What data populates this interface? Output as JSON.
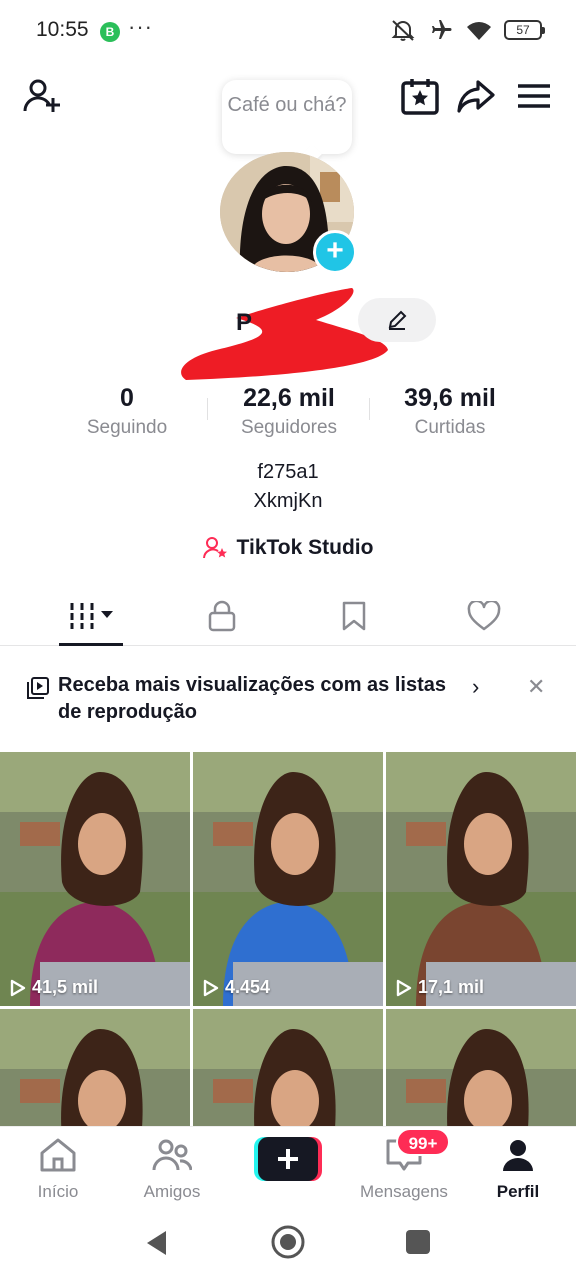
{
  "status_bar": {
    "time": "10:55",
    "notification_app": "B",
    "dots": "···",
    "battery": "57"
  },
  "header": {
    "note_bubble": "Café ou chá?"
  },
  "stats": {
    "following": {
      "value": "0",
      "label": "Seguindo"
    },
    "followers": {
      "value": "22,6 mil",
      "label": "Seguidores"
    },
    "likes": {
      "value": "39,6 mil",
      "label": "Curtidas"
    }
  },
  "bio": {
    "line1": "f275a1",
    "line2": "XkmjKn"
  },
  "studio_link": "TikTok Studio",
  "banner": {
    "text": "Receba mais visualizações com as listas de reprodução"
  },
  "videos": [
    {
      "views": "41,5 mil",
      "shirt_color": "#8e2a5c"
    },
    {
      "views": "4.454",
      "shirt_color": "#2f6fd0"
    },
    {
      "views": "17,1 mil",
      "shirt_color": "#7a4530"
    },
    {
      "views": "",
      "shirt_color": "#e0b640"
    },
    {
      "views": "",
      "shirt_color": "#3a7ad8"
    },
    {
      "views": "",
      "shirt_color": "#e0a84a"
    }
  ],
  "bottom_nav": {
    "home": "Início",
    "friends": "Amigos",
    "inbox": "Mensagens",
    "inbox_badge": "99+",
    "profile": "Perfil"
  },
  "colors": {
    "accent_cyan": "#20c5e6",
    "accent_red": "#fe2c55",
    "text_primary": "#161823",
    "text_secondary": "#8a8b91"
  }
}
